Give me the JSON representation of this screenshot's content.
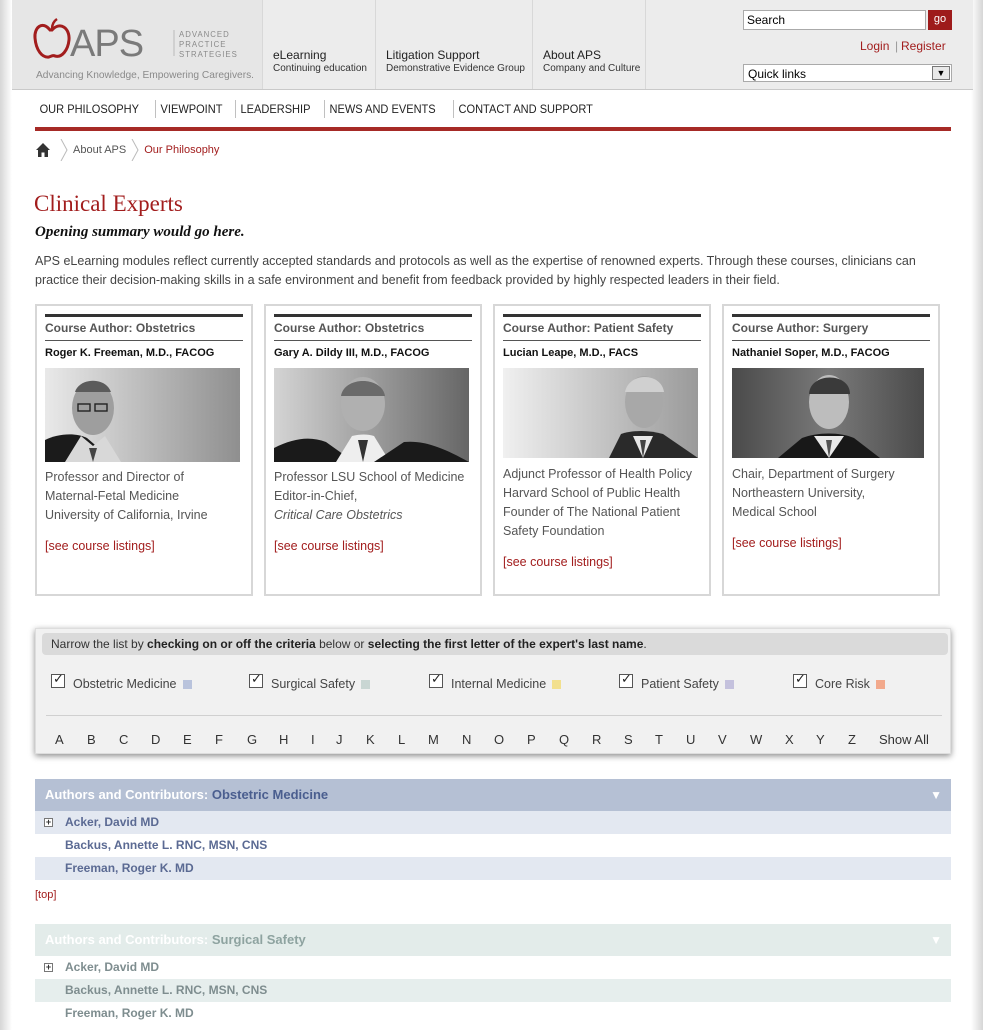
{
  "brand": {
    "name": "APS",
    "line1": "ADVANCED",
    "line2": "PRACTICE",
    "line3": "STRATEGIES",
    "tagline": "Advancing Knowledge, Empowering Caregivers.",
    "accent": "#a21d1d"
  },
  "mainnav": [
    {
      "title": "eLearning",
      "sub": "Continuing education"
    },
    {
      "title": "Litigation Support",
      "sub": "Demonstrative Evidence Group"
    },
    {
      "title": "About APS",
      "sub": "Company and Culture"
    }
  ],
  "search": {
    "value": "Search",
    "go": "go"
  },
  "account": {
    "login": "Login",
    "separator": "|",
    "register": "Register"
  },
  "quicklinks": {
    "selected": "Quick links"
  },
  "subnav": [
    "OUR PHILOSOPHY",
    "VIEWPOINT",
    "LEADERSHIP",
    "NEWS AND EVENTS",
    "CONTACT AND SUPPORT"
  ],
  "breadcrumb": {
    "parent": "About APS",
    "current": "Our Philosophy"
  },
  "page": {
    "title": "Clinical Experts",
    "subtitle": "Opening summary would go here.",
    "intro": "APS eLearning modules reflect currently accepted standards and protocols as well as the expertise of renowned experts. Through these courses, clinicians can practice their decision-making skills in a safe environment and benefit from feedback provided by highly respected leaders in their field."
  },
  "experts": [
    {
      "type": "Course Author: Obstetrics",
      "name": "Roger K. Freeman, M.D., FACOG",
      "lines": [
        "Professor and Director of",
        "Maternal-Fetal Medicine",
        "University of California, Irvine"
      ],
      "italic_line": "",
      "link": "[see course listings]"
    },
    {
      "type": "Course Author: Obstetrics",
      "name": "Gary A. Dildy III, M.D., FACOG",
      "lines": [
        "Professor LSU School of Medicine",
        "Editor-in-Chief,"
      ],
      "italic_line": "Critical Care Obstetrics",
      "link": "[see course listings]"
    },
    {
      "type": "Course Author: Patient Safety",
      "name": "Lucian Leape, M.D., FACS",
      "lines": [
        "Adjunct Professor of Health Policy",
        "Harvard School of Public Health",
        "Founder of The National Patient",
        "Safety Foundation"
      ],
      "italic_line": "",
      "link": "[see course listings]"
    },
    {
      "type": "Course Author: Surgery",
      "name": "Nathaniel Soper, M.D., FACOG",
      "lines": [
        "Chair, Department of Surgery",
        "Northeastern University,",
        "Medical School"
      ],
      "italic_line": "",
      "link": "[see course listings]"
    }
  ],
  "filter": {
    "pre": "Narrow the list by ",
    "bold1": "checking on or off the criteria",
    "mid": " below or ",
    "bold2": "selecting the first letter of the expert's last name",
    "post": ".",
    "criteria": [
      {
        "label": "Obstetric Medicine",
        "checked": true,
        "color": "#b9c3dc"
      },
      {
        "label": "Surgical Safety",
        "checked": true,
        "color": "#c9d6d3"
      },
      {
        "label": "Internal Medicine",
        "checked": true,
        "color": "#f2e08e"
      },
      {
        "label": "Patient Safety",
        "checked": true,
        "color": "#c4c1dd"
      },
      {
        "label": "Core Risk",
        "checked": true,
        "color": "#f2a98c"
      }
    ],
    "letters": [
      "A",
      "B",
      "C",
      "D",
      "E",
      "F",
      "G",
      "H",
      "I",
      "J",
      "K",
      "L",
      "M",
      "N",
      "O",
      "P",
      "Q",
      "R",
      "S",
      "T",
      "U",
      "V",
      "W",
      "X",
      "Y",
      "Z"
    ],
    "show_all": "Show All"
  },
  "sections": [
    {
      "prefix": "Authors and Contributors: ",
      "category": "Obstetric Medicine",
      "arrow": "▼",
      "rows": [
        "Acker, David MD",
        "Backus, Annette L. RNC, MSN, CNS",
        "Freeman, Roger K. MD"
      ]
    },
    {
      "prefix": "Authors and Contributors: ",
      "category": "Surgical Safety",
      "arrow": "▼",
      "rows": [
        "Acker, David MD",
        "Backus, Annette L. RNC, MSN, CNS",
        "Freeman, Roger K. MD"
      ]
    }
  ],
  "top_link": "[top]",
  "icons": {
    "home": "home-icon",
    "breadcrumb_sep": "chevron-right-icon",
    "expand": "plus-box-icon",
    "dropdown": "chevron-down-icon"
  }
}
